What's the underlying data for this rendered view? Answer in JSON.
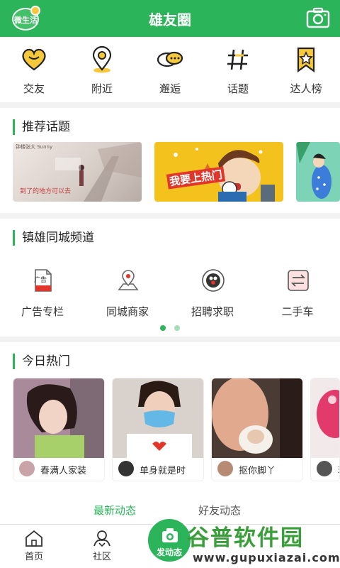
{
  "header": {
    "logo_text": "微生活",
    "title": "雄友圈",
    "camera_icon": "camera-icon"
  },
  "quick_nav": [
    {
      "label": "交友",
      "icon": "heart-icon"
    },
    {
      "label": "附近",
      "icon": "location-pin-icon"
    },
    {
      "label": "邂逅",
      "icon": "chat-bubbles-icon"
    },
    {
      "label": "话题",
      "icon": "hashtag-icon"
    },
    {
      "label": "达人榜",
      "icon": "star-bookmark-icon"
    }
  ],
  "topics": {
    "title": "推荐话题",
    "cards": [
      {
        "caption": "钟楼张大 Sunny",
        "overlay": "到了的地方可以去"
      },
      {
        "caption": "我要上热门"
      },
      {
        "caption": ""
      }
    ]
  },
  "channel": {
    "title": "镇雄同城频道",
    "items": [
      {
        "label": "广告专栏",
        "icon": "ad-document-icon",
        "icon_text": "广告"
      },
      {
        "label": "同城商家",
        "icon": "map-pin-icon"
      },
      {
        "label": "招聘求职",
        "icon": "recruit-icon"
      },
      {
        "label": "二手车",
        "icon": "exchange-icon"
      }
    ],
    "page_count": 2,
    "active_page": 1
  },
  "hot": {
    "title": "今日热门",
    "cards": [
      {
        "name": "春满人家装"
      },
      {
        "name": "单身就是时"
      },
      {
        "name": "抠你脚丫"
      },
      {
        "name": "若"
      }
    ]
  },
  "feed_tabs": {
    "latest": "最新动态",
    "friends": "好友动态"
  },
  "bottom_nav": {
    "home": "首页",
    "community": "社区",
    "post": "发动态"
  },
  "watermark": {
    "title": "谷普软件园",
    "url": "www.gupuxiazai.com"
  },
  "colors": {
    "accent": "#2bb459",
    "icon_yellow": "#f6c83c"
  }
}
